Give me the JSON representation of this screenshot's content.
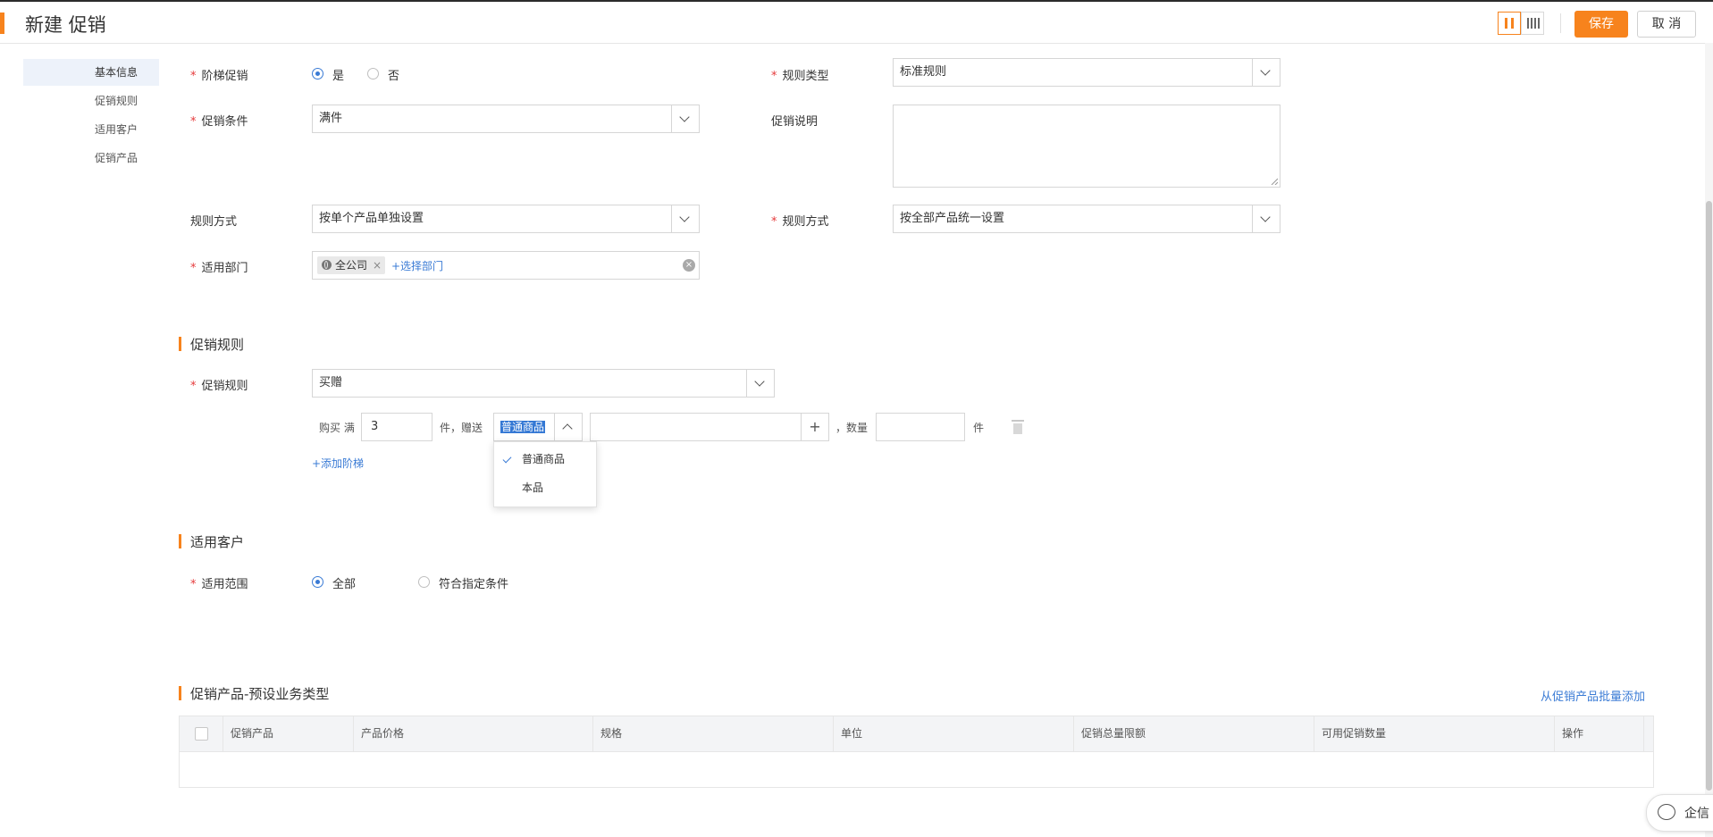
{
  "header": {
    "title": "新建 促销",
    "save_label": "保存",
    "cancel_label": "取 消"
  },
  "nav": {
    "items": [
      "基本信息",
      "促销规则",
      "适用客户",
      "促销产品"
    ]
  },
  "form": {
    "tiered": {
      "label": "阶梯促销",
      "options": [
        "是",
        "否"
      ],
      "selected": "是"
    },
    "rule_type": {
      "label": "规则类型",
      "value": "标准规则"
    },
    "condition": {
      "label": "促销条件",
      "value": "满件"
    },
    "description": {
      "label": "促销说明",
      "value": ""
    },
    "rule_mode_left": {
      "label": "规则方式",
      "value": "按单个产品单独设置"
    },
    "rule_mode_right": {
      "label": "规则方式",
      "value": "按全部产品统一设置"
    },
    "department": {
      "label": "适用部门",
      "tag": "全公司",
      "add_link": "+选择部门"
    }
  },
  "rules": {
    "section_title": "促销规则",
    "label": "促销规则",
    "value": "买赠",
    "tier": {
      "buy_prefix": "购买 满",
      "buy_qty": "3",
      "mid_text": "件，赠送",
      "gift_type": "普通商品",
      "gift_product": "",
      "qty_label": "，数量",
      "qty_value": "",
      "unit": "件"
    },
    "add_tier": "+添加阶梯",
    "dropdown": {
      "options": [
        "普通商品",
        "本品"
      ],
      "selected": "普通商品"
    }
  },
  "customers": {
    "section_title": "适用客户",
    "label": "适用范围",
    "options": [
      "全部",
      "符合指定条件"
    ],
    "selected": "全部"
  },
  "products": {
    "section_title": "促销产品-预设业务类型",
    "batch_link": "从促销产品批量添加",
    "columns": [
      "促销产品",
      "产品价格",
      "规格",
      "单位",
      "促销总量限额",
      "可用促销数量",
      "操作"
    ]
  },
  "chat": {
    "label": "企信"
  },
  "colors": {
    "accent": "#f7831d",
    "link": "#3a7bd5",
    "required": "#e5393b"
  }
}
